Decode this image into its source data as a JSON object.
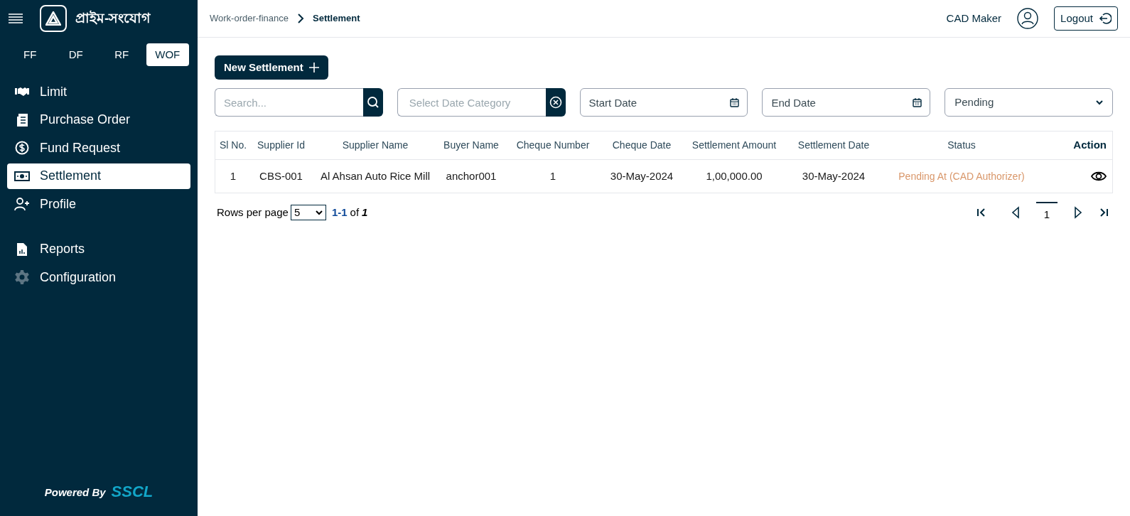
{
  "sidebar": {
    "brand": "প্রাইম-সংযোগ",
    "modules": [
      {
        "label": "FF",
        "selected": false
      },
      {
        "label": "DF",
        "selected": false
      },
      {
        "label": "RF",
        "selected": false
      },
      {
        "label": "WOF",
        "selected": true
      }
    ],
    "items": [
      {
        "label": "Limit",
        "kind": "handshake",
        "selected": false
      },
      {
        "label": "Purchase Order",
        "kind": "document",
        "selected": false
      },
      {
        "label": "Fund Request",
        "kind": "dollar",
        "selected": false
      },
      {
        "label": "Settlement",
        "kind": "banknote",
        "selected": true
      },
      {
        "label": "Profile",
        "kind": "useradd",
        "selected": false
      },
      {
        "label": "Reports",
        "kind": "report",
        "selected": false
      },
      {
        "label": "Configuration",
        "kind": "gear",
        "selected": false
      }
    ],
    "footer": {
      "label": "Powered By",
      "company": "SSCL"
    }
  },
  "header": {
    "breadcrumb": [
      "Work-order-finance",
      "Settlement"
    ],
    "user": "CAD Maker",
    "logout": "Logout"
  },
  "toolbar": {
    "new_button": "New Settlement",
    "search": {
      "placeholder": "Search..."
    },
    "date_category": {
      "placeholder": "Select Date Category"
    },
    "start_date": {
      "placeholder": "Start Date"
    },
    "end_date": {
      "placeholder": "End Date"
    },
    "status": {
      "value": "Pending"
    }
  },
  "table": {
    "columns": [
      "Sl No.",
      "Supplier Id",
      "Supplier Name",
      "Buyer Name",
      "Cheque Number",
      "Cheque Date",
      "Settlement Amount",
      "Settlement Date",
      "Status",
      "Action"
    ],
    "rows": [
      {
        "cells": [
          "1",
          "CBS-001",
          "Al Ahsan Auto Rice Mill",
          "anchor001",
          "1",
          "30-May-2024",
          "1,00,000.00",
          "30-May-2024",
          "Pending At (CAD Authorizer)"
        ]
      }
    ]
  },
  "pagination": {
    "rows_label": "Rows per page",
    "rows_value": "5",
    "range": "1-1",
    "of": "of",
    "total": "1",
    "page": "1"
  }
}
